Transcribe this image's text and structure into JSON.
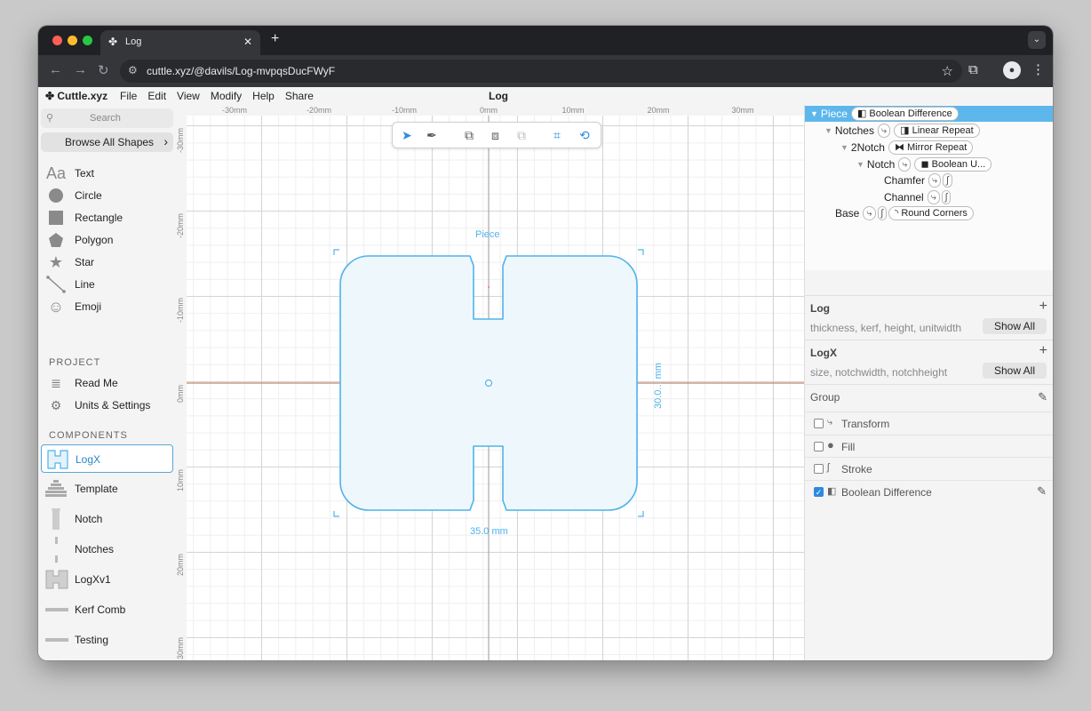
{
  "browser": {
    "tab_title": "Log",
    "url": "cuttle.xyz/@davils/Log-mvpqsDucFWyF",
    "traffic_lights": [
      "#ff5f57",
      "#febc2e",
      "#28c840"
    ]
  },
  "app": {
    "logo": "Cuttle.xyz",
    "menu": [
      "File",
      "Edit",
      "View",
      "Modify",
      "Help",
      "Share"
    ],
    "document_title": "Log"
  },
  "left_panel": {
    "search_placeholder": "Search",
    "browse_label": "Browse All Shapes",
    "shapes": [
      {
        "label": "Text",
        "icon": "text-icon"
      },
      {
        "label": "Circle",
        "icon": "circle-icon"
      },
      {
        "label": "Rectangle",
        "icon": "rectangle-icon"
      },
      {
        "label": "Polygon",
        "icon": "polygon-icon"
      },
      {
        "label": "Star",
        "icon": "star-icon"
      },
      {
        "label": "Line",
        "icon": "line-icon"
      },
      {
        "label": "Emoji",
        "icon": "emoji-icon"
      }
    ],
    "project_heading": "PROJECT",
    "project_items": [
      {
        "label": "Read Me",
        "icon": "document-icon"
      },
      {
        "label": "Units & Settings",
        "icon": "gear-icon"
      }
    ],
    "components_heading": "COMPONENTS",
    "components": [
      "LogX",
      "Template",
      "Notch",
      "Notches",
      "LogXv1",
      "Kerf Comb",
      "Testing"
    ]
  },
  "canvas": {
    "ruler_top": [
      "-30mm",
      "-20mm",
      "-10mm",
      "0mm",
      "10mm",
      "20mm",
      "30mm"
    ],
    "ruler_left": [
      "-30mm",
      "-20mm",
      "-10mm",
      "0mm",
      "10mm",
      "20mm",
      "30mm"
    ],
    "shape_label": "Piece",
    "width_dim": "35.0 mm",
    "height_dim": "30.0... mm",
    "accent": "#4fb3ea",
    "axis_color": "#b5654a"
  },
  "tree": {
    "piece": {
      "label": "Piece",
      "op": "Boolean Difference"
    },
    "notches": {
      "label": "Notches",
      "op": "Linear Repeat"
    },
    "twonotch": {
      "label": "2Notch",
      "op": "Mirror Repeat"
    },
    "notch": {
      "label": "Notch",
      "op": "Boolean U..."
    },
    "chamfer": {
      "label": "Chamfer"
    },
    "channel": {
      "label": "Channel"
    },
    "base": {
      "label": "Base",
      "op": "Round Corners"
    }
  },
  "inspector": {
    "log": {
      "title": "Log",
      "params": "thickness, kerf, height, unitwidth",
      "show_all": "Show All"
    },
    "logx": {
      "title": "LogX",
      "params": "size, notchwidth, notchheight",
      "show_all": "Show All"
    },
    "group": {
      "title": "Group"
    },
    "properties": [
      {
        "label": "Transform",
        "checked": false,
        "icon": "transform-icon"
      },
      {
        "label": "Fill",
        "checked": false,
        "icon": "fill-icon"
      },
      {
        "label": "Stroke",
        "checked": false,
        "icon": "stroke-icon"
      },
      {
        "label": "Boolean Difference",
        "checked": true,
        "icon": "boolean-difference-icon"
      }
    ]
  }
}
